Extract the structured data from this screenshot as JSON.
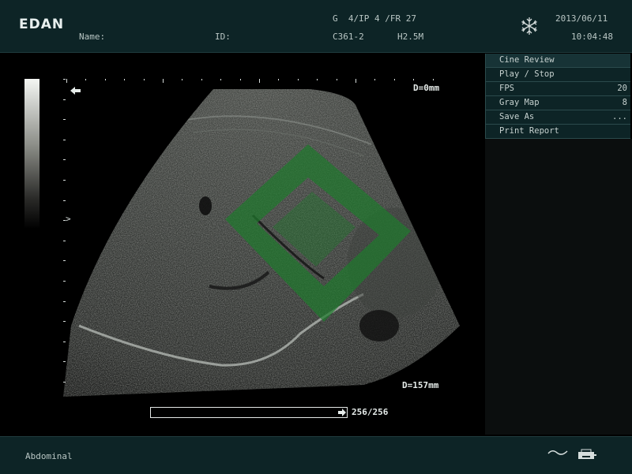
{
  "header": {
    "brand": "EDAN",
    "name_label": "Name:",
    "id_label": "ID:",
    "params_line1": "G  4/IP 4 /FR 27",
    "probe": "C361-2",
    "frequency": "H2.5M",
    "date": "2013/06/11",
    "time": "10:04:48",
    "freeze_icon": "snowflake-icon"
  },
  "image": {
    "depth_top": "D=0mm",
    "depth_bottom": "D=157mm",
    "focus_marker": ">",
    "orientation_icon": "left-arrow-icon",
    "cine_count": "256/256",
    "cine_progress": 1.0
  },
  "menu": {
    "items": [
      {
        "label": "Cine Review",
        "value": ""
      },
      {
        "label": "Play / Stop",
        "value": ""
      },
      {
        "label": "FPS",
        "value": "20"
      },
      {
        "label": "Gray Map",
        "value": "8"
      },
      {
        "label": "Save As",
        "value": "..."
      },
      {
        "label": "Print Report",
        "value": ""
      }
    ]
  },
  "footer": {
    "preset": "Abdominal",
    "wave_icon": "tilde-wave-icon",
    "print_icon": "printer-icon"
  },
  "colors": {
    "panel": "#0d2426",
    "watermark": "#1f7a2e"
  }
}
